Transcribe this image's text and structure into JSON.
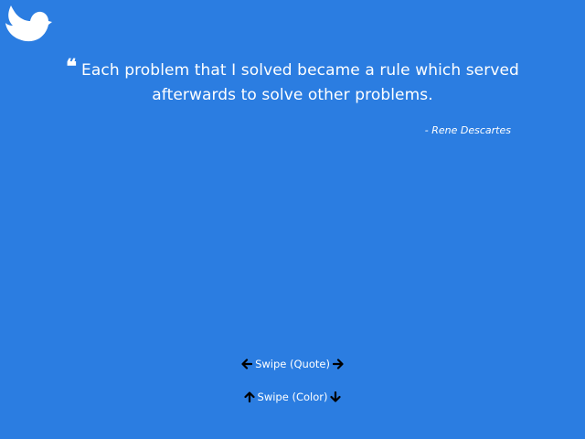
{
  "background_color": "#2b7de1",
  "text_color": "#ffffff",
  "tweet": {
    "icon": "bird-icon"
  },
  "quote": {
    "open_mark": "❝",
    "line1": "Each problem that I solved became a rule which served",
    "line2": "afterwards to solve other problems.",
    "author": "- Rene Descartes"
  },
  "controls": {
    "quote_swipe_label": "Swipe (Quote)",
    "color_swipe_label": "Swipe (Color)",
    "icons": [
      "arrow-left-icon",
      "arrow-right-icon",
      "arrow-up-icon",
      "arrow-down-icon"
    ]
  }
}
